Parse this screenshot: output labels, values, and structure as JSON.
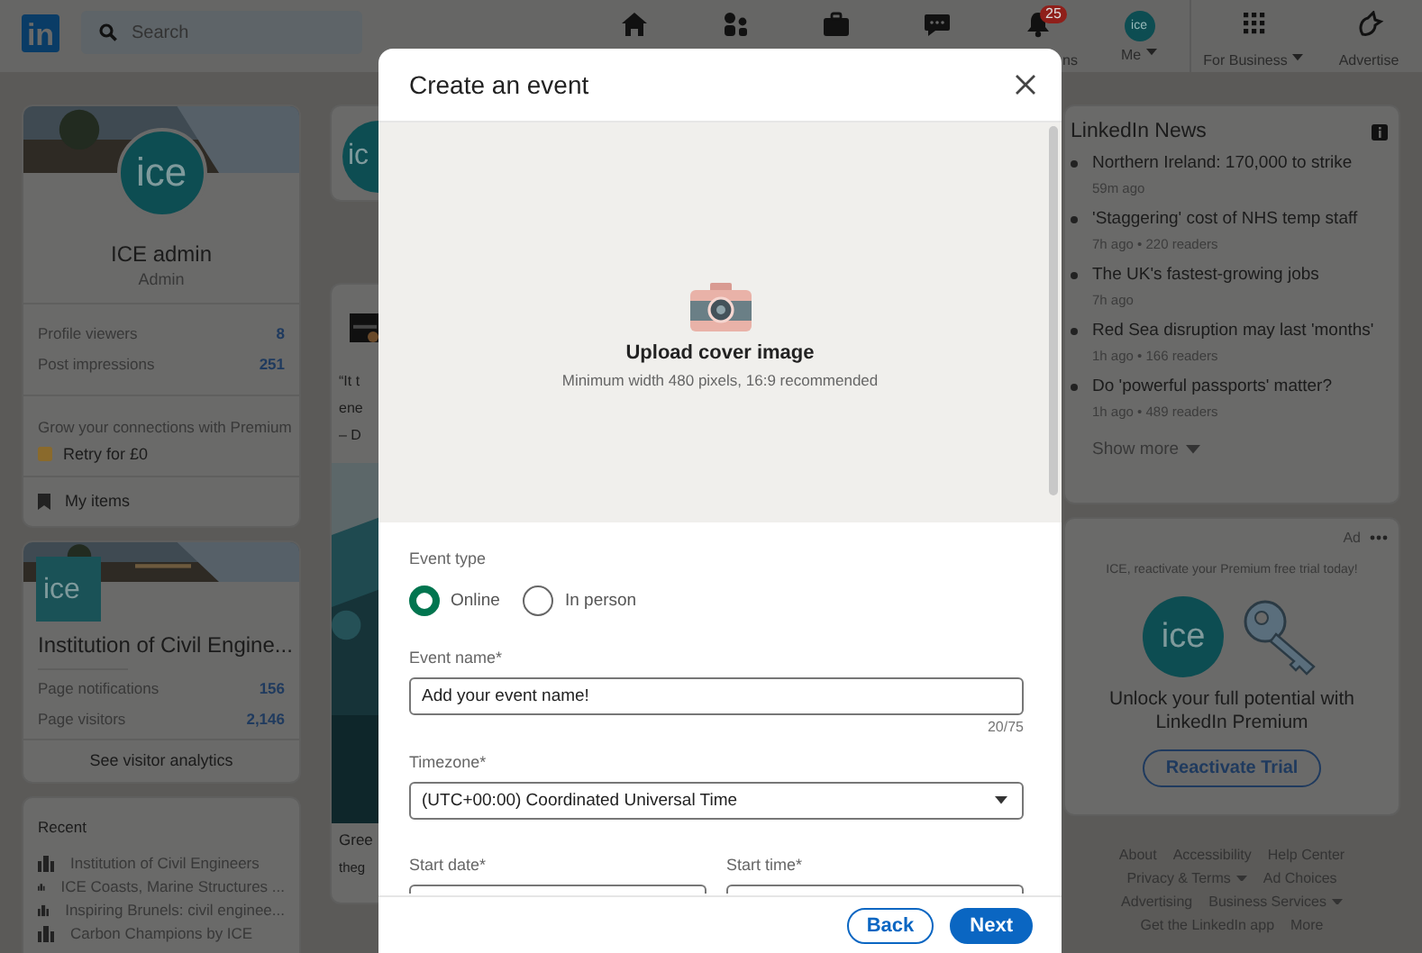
{
  "nav": {
    "logo": "in",
    "search": {
      "placeholder": "Search"
    },
    "items": [
      {
        "kind": "home"
      },
      {
        "kind": "network"
      },
      {
        "kind": "jobs"
      },
      {
        "kind": "messaging"
      },
      {
        "kind": "notifications",
        "label": "ns",
        "badge": "25"
      },
      {
        "kind": "me",
        "avatar": "ice",
        "label": "Me"
      },
      {
        "kind": "business",
        "label": "For Business"
      },
      {
        "kind": "advertise",
        "label": "Advertise"
      }
    ]
  },
  "profile": {
    "avatar": "ice",
    "name": "ICE admin",
    "headline": "Admin",
    "stats": [
      {
        "label": "Profile viewers",
        "value": "8"
      },
      {
        "label": "Post impressions",
        "value": "251"
      }
    ],
    "premium": {
      "text": "Grow your connections with Premium",
      "link": "Retry for £0"
    },
    "my_items": "My items"
  },
  "page_card": {
    "logo": "ice",
    "name": "Institution of Civil Engine...",
    "stats": [
      {
        "label": "Page notifications",
        "value": "156"
      },
      {
        "label": "Page visitors",
        "value": "2,146"
      }
    ],
    "action": "See visitor analytics"
  },
  "recent": {
    "title": "Recent",
    "items": [
      "Institution of Civil Engineers",
      "ICE Coasts, Marine Structures ...",
      "Inspiring Brunels: civil enginee...",
      "Carbon Champions by ICE"
    ]
  },
  "feed": {
    "avatar": "ic",
    "lines": [
      "“It t",
      "ene",
      "– D"
    ],
    "title": "Gree",
    "subtitle": "theg"
  },
  "news": {
    "title": "LinkedIn News",
    "items": [
      {
        "headline": "Northern Ireland: 170,000 to strike",
        "meta": "59m ago"
      },
      {
        "headline": "'Staggering' cost of NHS temp staff",
        "meta": "7h ago • 220 readers"
      },
      {
        "headline": "The UK's fastest-growing jobs",
        "meta": "7h ago"
      },
      {
        "headline": "Red Sea disruption may last 'months'",
        "meta": "1h ago • 166 readers"
      },
      {
        "headline": "Do 'powerful passports' matter?",
        "meta": "1h ago • 489 readers"
      }
    ],
    "show_more": "Show more"
  },
  "ad": {
    "label": "Ad",
    "text": "ICE, reactivate your Premium free trial today!",
    "logo": "ice",
    "headline": "Unlock your full potential with LinkedIn Premium",
    "button": "Reactivate Trial"
  },
  "footer_links": [
    [
      {
        "label": "About",
        "dropdown": false
      },
      {
        "label": "Accessibility",
        "dropdown": false
      },
      {
        "label": "Help Center",
        "dropdown": false
      }
    ],
    [
      {
        "label": "Privacy & Terms",
        "dropdown": true
      },
      {
        "label": "Ad Choices",
        "dropdown": false
      }
    ],
    [
      {
        "label": "Advertising",
        "dropdown": false
      },
      {
        "label": "Business Services",
        "dropdown": true
      }
    ],
    [
      {
        "label": "Get the LinkedIn app",
        "dropdown": false
      },
      {
        "label": "More",
        "dropdown": false
      }
    ]
  ],
  "modal": {
    "title": "Create an event",
    "cover": {
      "title": "Upload cover image",
      "hint": "Minimum width 480 pixels, 16:9 recommended"
    },
    "event_type": {
      "label": "Event type",
      "options": [
        {
          "label": "Online",
          "selected": true
        },
        {
          "label": "In person",
          "selected": false
        }
      ]
    },
    "event_name": {
      "label": "Event name*",
      "value": "Add your event name!",
      "counter": "20/75"
    },
    "timezone": {
      "label": "Timezone*",
      "value": "(UTC+00:00) Coordinated Universal Time"
    },
    "start_date": {
      "label": "Start date*"
    },
    "start_time": {
      "label": "Start time*"
    },
    "buttons": [
      {
        "label": "Back",
        "kind": "secondary"
      },
      {
        "label": "Next",
        "kind": "primary"
      }
    ]
  }
}
